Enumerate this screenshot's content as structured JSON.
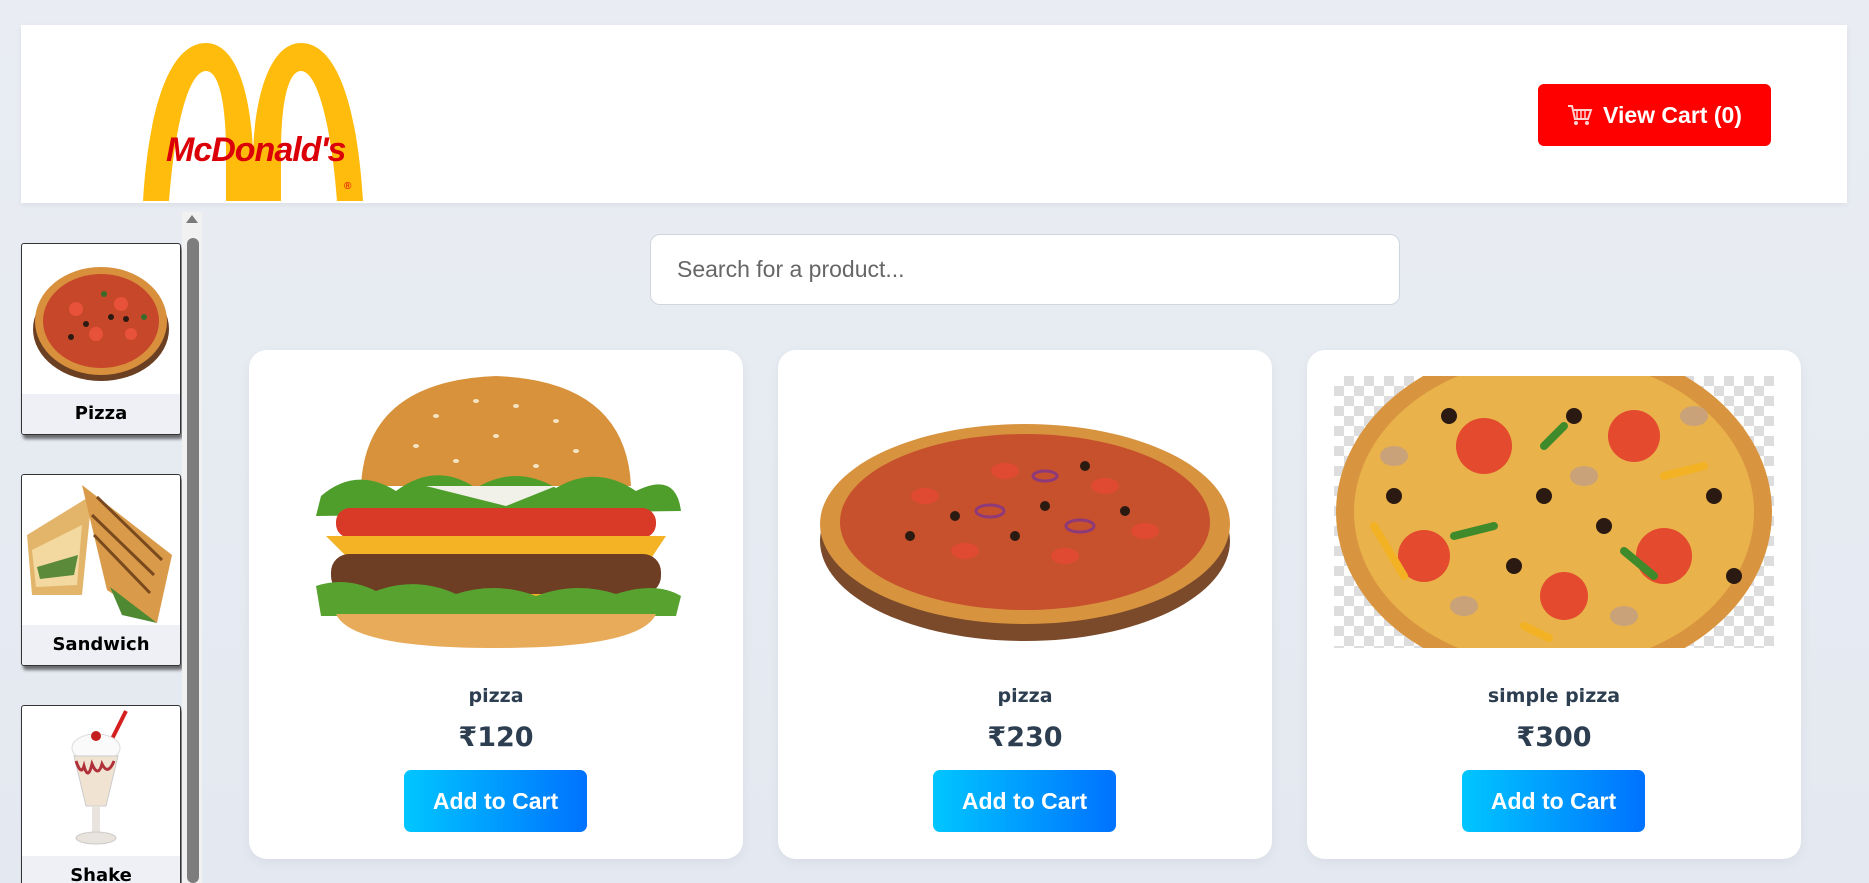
{
  "header": {
    "logo_text": "McDonald's",
    "logo_reg": "®",
    "cart_label": "View Cart (0)",
    "cart_icon": "cart-icon",
    "brand_red": "#ff0000",
    "arch_yellow": "#ffbc0d"
  },
  "sidebar": {
    "categories": [
      {
        "label": "Pizza",
        "icon": "pizza-image"
      },
      {
        "label": "Sandwich",
        "icon": "sandwich-image"
      },
      {
        "label": "Shake",
        "icon": "shake-image"
      }
    ]
  },
  "search": {
    "placeholder": "Search for a product..."
  },
  "products": [
    {
      "name": "pizza",
      "price": "₹120",
      "button": "Add to Cart",
      "image": "burger-image"
    },
    {
      "name": "pizza",
      "price": "₹230",
      "button": "Add to Cart",
      "image": "pizza-board-image"
    },
    {
      "name": "simple pizza",
      "price": "₹300",
      "button": "Add to Cart",
      "image": "pizza-transparent-image"
    }
  ],
  "colors": {
    "button_gradient_start": "#00c6ff",
    "button_gradient_end": "#0072ff",
    "text_dark": "#2c3e50"
  }
}
